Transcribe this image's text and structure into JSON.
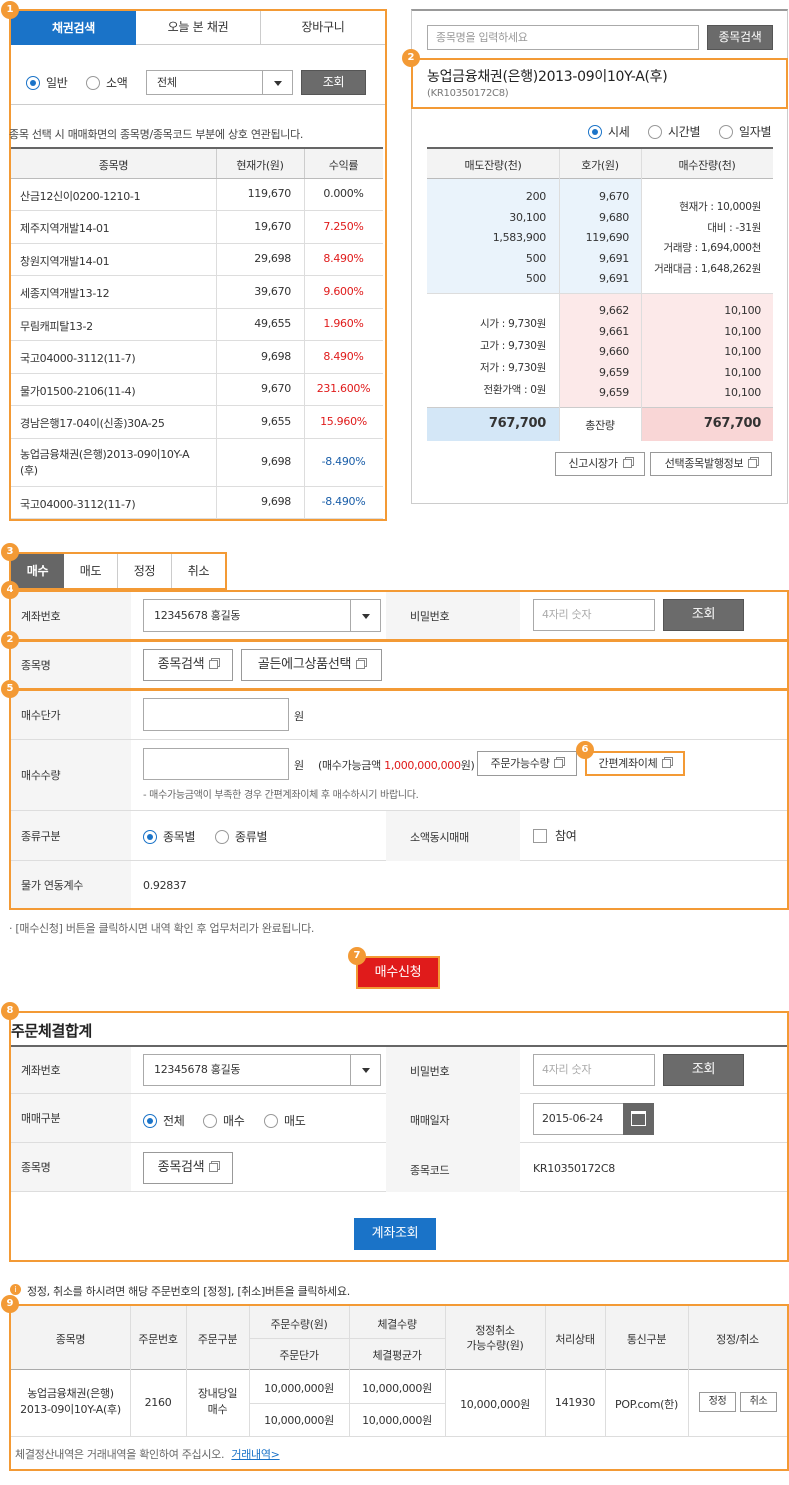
{
  "badges": {
    "b1": "1",
    "b2": "2",
    "b3": "3",
    "b4": "4",
    "b2b": "2",
    "b5": "5",
    "b6": "6",
    "b7": "7",
    "b8": "8",
    "b9": "9"
  },
  "left_panel": {
    "tabs": [
      "채권검색",
      "오늘 본 채권",
      "장바구니"
    ],
    "radio_normal": "일반",
    "radio_small": "소액",
    "select_value": "전체",
    "search_button": "조회",
    "notice": "종목 선택 시 매매화면의 종목명/종목코드 부분에 상호 연관됩니다.",
    "headers": [
      "종목명",
      "현재가(원)",
      "수익률"
    ],
    "rows": [
      {
        "name": "산금12신이0200-1210-1",
        "price": "119,670",
        "yield": "0.000%",
        "color": "black"
      },
      {
        "name": "제주지역개발14-01",
        "price": "19,670",
        "yield": "7.250%",
        "color": "red"
      },
      {
        "name": "창원지역개발14-01",
        "price": "29,698",
        "yield": "8.490%",
        "color": "red"
      },
      {
        "name": "세종지역개발13-12",
        "price": "39,670",
        "yield": "9.600%",
        "color": "red"
      },
      {
        "name": "무림캐피탈13-2",
        "price": "49,655",
        "yield": "1.960%",
        "color": "red"
      },
      {
        "name": "국고04000-3112(11-7)",
        "price": "9,698",
        "yield": "8.490%",
        "color": "red"
      },
      {
        "name": "물가01500-2106(11-4)",
        "price": "9,670",
        "yield": "231.600%",
        "color": "red"
      },
      {
        "name": "경남은행17-04이(신종)30A-25",
        "price": "9,655",
        "yield": "15.960%",
        "color": "red"
      },
      {
        "name": "농업금융채권(은행)2013-09이10Y-A",
        "name2": "(후)",
        "price": "9,698",
        "yield": "-8.490%",
        "color": "blue"
      },
      {
        "name": "국고04000-3112(11-7)",
        "price": "9,698",
        "yield": "-8.490%",
        "color": "blue"
      }
    ]
  },
  "right_panel": {
    "search_placeholder": "종목명을 입력하세요",
    "search_button": "종목검색",
    "bond_title": "농업금융채권(은행)2013-09이10Y-A(후)",
    "bond_code": "(KR10350172C8)",
    "radios": [
      "시세",
      "시간별",
      "일자별"
    ],
    "headers": [
      "매도잔량(천)",
      "호가(원)",
      "매수잔량(천)"
    ],
    "sell_qty": [
      "200",
      "30,100",
      "1,583,900",
      "500",
      "500"
    ],
    "sell_price": [
      "9,670",
      "9,680",
      "119,690",
      "9,691",
      "9,691"
    ],
    "info": [
      "현재가 : 10,000원",
      "대비 : -31원",
      "거래량 : 1,694,000천",
      "거래대금 : 1,648,262원"
    ],
    "buy_price": [
      "9,662",
      "9,661",
      "9,660",
      "9,659",
      "9,659"
    ],
    "buy_qty": [
      "10,100",
      "10,100",
      "10,100",
      "10,100",
      "10,100"
    ],
    "ohlc": [
      "시가 : 9,730원",
      "고가 : 9,730원",
      "저가 : 9,730원",
      "전환가액 : 0원"
    ],
    "total_sell": "767,700",
    "total_label": "총잔량",
    "total_buy": "767,700",
    "btn_report": "신고시장가",
    "btn_issue": "선택종목발행정보"
  },
  "order": {
    "tabs": [
      "매수",
      "매도",
      "정정",
      "취소"
    ],
    "account_label": "계좌번호",
    "account_value": "12345678 홍길동",
    "password_label": "비밀번호",
    "password_placeholder": "4자리 숫자",
    "query_button": "조회",
    "item_label": "종목명",
    "item_search": "종목검색",
    "golden_select": "골든에그상품선택",
    "price_label": "매수단가",
    "won": "원",
    "qty_label": "매수수량",
    "won2": "원",
    "avail_prefix": "(매수가능금액",
    "avail_amount": "1,000,000,000",
    "avail_suffix": "원)",
    "avail_qty_button": "주문가능수량",
    "transfer_button": "간편계좌이체",
    "qty_note": "- 매수가능금액이 부족한 경우 간편계좌이체 후 매수하시기 바랍니다.",
    "type_label": "종류구분",
    "type_item": "종목별",
    "type_kind": "종류별",
    "odd_label": "소액동시매매",
    "odd_check": "참여",
    "inflation_label": "물가 연동계수",
    "inflation_value": "0.92837",
    "notice": "· [매수신청] 버튼을 클릭하시면 내역 확인 후 업무처리가 완료됩니다.",
    "submit_button": "매수신청"
  },
  "summary": {
    "title": "주문체결합계",
    "account_label": "계좌번호",
    "account_value": "12345678 홍길동",
    "password_label": "비밀번호",
    "password_placeholder": "4자리 숫자",
    "query_button": "조회",
    "trade_label": "매매구분",
    "trade_all": "전체",
    "trade_buy": "매수",
    "trade_sell": "매도",
    "date_label": "매매일자",
    "date_value": "2015-06-24",
    "item_label": "종목명",
    "item_search": "종목검색",
    "code_label": "종목코드",
    "code_value": "KR10350172C8",
    "account_query": "계좌조회"
  },
  "orders": {
    "notice": "정정, 취소를 하시려면 해당 주문번호의 [정정], [취소]버튼을 클릭하세요.",
    "h_name": "종목명",
    "h_no": "주문번호",
    "h_type": "주문구분",
    "h_qty": "주문수량(원)",
    "h_price": "주문단가",
    "h_fill": "체결수량",
    "h_avg": "체결평균가",
    "h_mod1": "정정취소",
    "h_mod2": "가능수량(원)",
    "h_status": "처리상태",
    "h_channel": "통신구분",
    "h_action": "정정/취소",
    "row": {
      "name1": "농업금융채권(은행)",
      "name2": "2013-09이10Y-A(후)",
      "no": "2160",
      "type1": "장내당일",
      "type2": "매수",
      "qty": "10,000,000원",
      "price": "10,000,000원",
      "fill": "10,000,000원",
      "avg": "10,000,000원",
      "mod": "10,000,000원",
      "status": "141930",
      "channel": "POP.com(한)",
      "btn_mod": "정정",
      "btn_cancel": "취소"
    },
    "footer": "체결정산내역은 거래내역을 확인하여 주십시오.",
    "footer_link": "거래내역>"
  }
}
